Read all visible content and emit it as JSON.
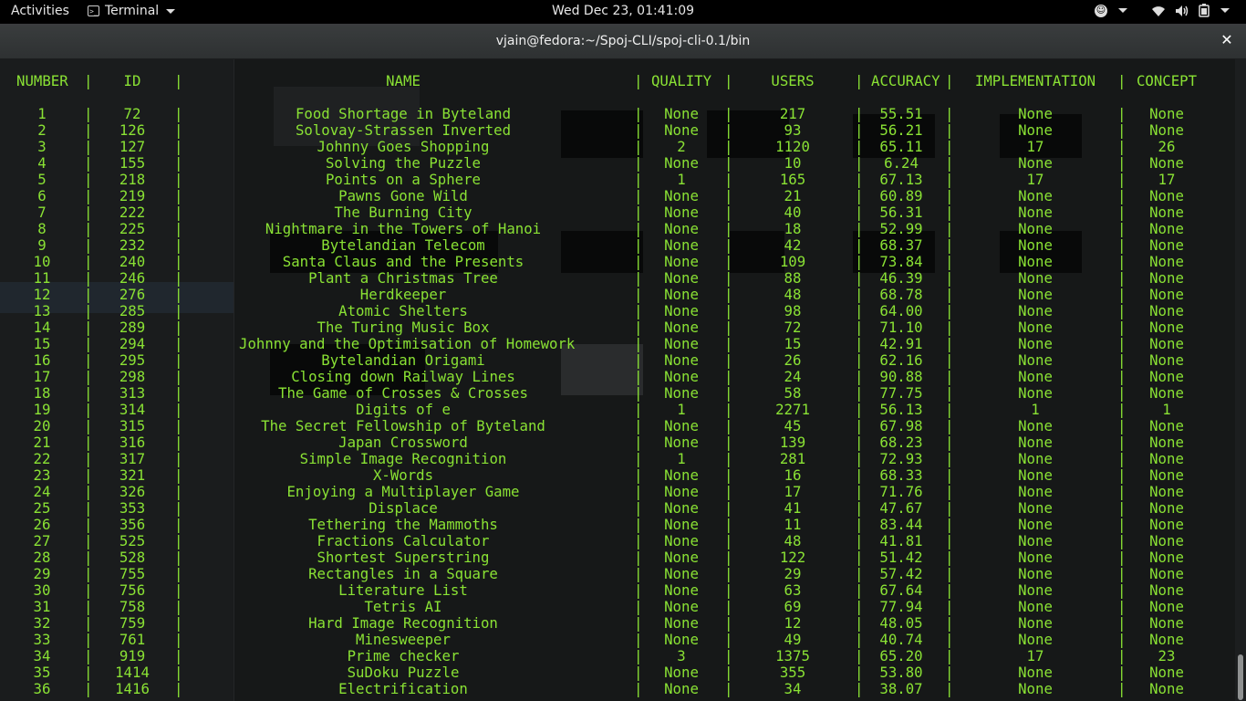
{
  "topbar": {
    "activities": "Activities",
    "app_name": "Terminal",
    "clock": "Wed Dec 23, 01:41:09"
  },
  "window": {
    "title": "vjain@fedora:~/Spoj-CLI/spoj-cli-0.1/bin",
    "close_glyph": "✕"
  },
  "table": {
    "headers": {
      "number": "NUMBER",
      "id": "ID",
      "name": "NAME",
      "quality": "QUALITY",
      "users": "USERS",
      "accuracy": "ACCURACY",
      "implementation": "IMPLEMENTATION",
      "concept": "CONCEPT"
    },
    "rows": [
      [
        "1",
        "72",
        "Food Shortage in Byteland",
        "None",
        "217",
        "55.51",
        "None",
        "None"
      ],
      [
        "2",
        "126",
        "Solovay-Strassen Inverted",
        "None",
        "93",
        "56.21",
        "None",
        "None"
      ],
      [
        "3",
        "127",
        "Johnny Goes Shopping",
        "2",
        "1120",
        "65.11",
        "17",
        "26"
      ],
      [
        "4",
        "155",
        "Solving the Puzzle",
        "None",
        "10",
        "6.24",
        "None",
        "None"
      ],
      [
        "5",
        "218",
        "Points on a Sphere",
        "1",
        "165",
        "67.13",
        "17",
        "17"
      ],
      [
        "6",
        "219",
        "Pawns Gone Wild",
        "None",
        "21",
        "60.89",
        "None",
        "None"
      ],
      [
        "7",
        "222",
        "The Burning City",
        "None",
        "40",
        "56.31",
        "None",
        "None"
      ],
      [
        "8",
        "225",
        "Nightmare in the Towers of Hanoi",
        "None",
        "18",
        "52.99",
        "None",
        "None"
      ],
      [
        "9",
        "232",
        "Bytelandian Telecom",
        "None",
        "42",
        "68.37",
        "None",
        "None"
      ],
      [
        "10",
        "240",
        "Santa Claus and the Presents",
        "None",
        "109",
        "73.84",
        "None",
        "None"
      ],
      [
        "11",
        "246",
        "Plant a Christmas Tree",
        "None",
        "88",
        "46.39",
        "None",
        "None"
      ],
      [
        "12",
        "276",
        "Herdkeeper",
        "None",
        "48",
        "68.78",
        "None",
        "None"
      ],
      [
        "13",
        "285",
        "Atomic Shelters",
        "None",
        "98",
        "64.00",
        "None",
        "None"
      ],
      [
        "14",
        "289",
        "The Turing Music Box",
        "None",
        "72",
        "71.10",
        "None",
        "None"
      ],
      [
        "15",
        "294",
        "Johnny and the Optimisation of Homework",
        "None",
        "15",
        "42.91",
        "None",
        "None"
      ],
      [
        "16",
        "295",
        "Bytelandian Origami",
        "None",
        "26",
        "62.16",
        "None",
        "None"
      ],
      [
        "17",
        "298",
        "Closing down Railway Lines",
        "None",
        "24",
        "90.88",
        "None",
        "None"
      ],
      [
        "18",
        "313",
        "The Game of Crosses & Crosses",
        "None",
        "58",
        "77.75",
        "None",
        "None"
      ],
      [
        "19",
        "314",
        "Digits of e",
        "1",
        "2271",
        "56.13",
        "1",
        "1"
      ],
      [
        "20",
        "315",
        "The Secret Fellowship of Byteland",
        "None",
        "45",
        "67.98",
        "None",
        "None"
      ],
      [
        "21",
        "316",
        "Japan Crossword",
        "None",
        "139",
        "68.23",
        "None",
        "None"
      ],
      [
        "22",
        "317",
        "Simple Image Recognition",
        "1",
        "281",
        "72.93",
        "None",
        "None"
      ],
      [
        "23",
        "321",
        "X-Words",
        "None",
        "16",
        "68.33",
        "None",
        "None"
      ],
      [
        "24",
        "326",
        "Enjoying a Multiplayer Game",
        "None",
        "17",
        "71.76",
        "None",
        "None"
      ],
      [
        "25",
        "353",
        "Displace",
        "None",
        "41",
        "47.67",
        "None",
        "None"
      ],
      [
        "26",
        "356",
        "Tethering the Mammoths",
        "None",
        "11",
        "83.44",
        "None",
        "None"
      ],
      [
        "27",
        "525",
        "Fractions Calculator",
        "None",
        "48",
        "41.81",
        "None",
        "None"
      ],
      [
        "28",
        "528",
        "Shortest Superstring",
        "None",
        "122",
        "51.42",
        "None",
        "None"
      ],
      [
        "29",
        "755",
        "Rectangles in a Square",
        "None",
        "29",
        "57.42",
        "None",
        "None"
      ],
      [
        "30",
        "756",
        "Literature List",
        "None",
        "63",
        "67.64",
        "None",
        "None"
      ],
      [
        "31",
        "758",
        "Tetris AI",
        "None",
        "69",
        "77.94",
        "None",
        "None"
      ],
      [
        "32",
        "759",
        "Hard Image Recognition",
        "None",
        "12",
        "48.05",
        "None",
        "None"
      ],
      [
        "33",
        "761",
        "Minesweeper",
        "None",
        "49",
        "40.74",
        "None",
        "None"
      ],
      [
        "34",
        "919",
        "Prime checker",
        "3",
        "1375",
        "65.20",
        "17",
        "23"
      ],
      [
        "35",
        "1414",
        "SuDoku Puzzle",
        "None",
        "355",
        "53.80",
        "None",
        "None"
      ],
      [
        "36",
        "1416",
        "Electrification",
        "None",
        "34",
        "38.07",
        "None",
        "None"
      ]
    ]
  },
  "colors": {
    "terminal_text": "#8ae234",
    "terminal_bg": "#161818",
    "topbar_bg": "#000000"
  },
  "icons": [
    "terminal-icon",
    "accessibility-icon",
    "wifi-icon",
    "volume-icon",
    "battery-icon",
    "close-icon",
    "chevron-down-icon"
  ]
}
